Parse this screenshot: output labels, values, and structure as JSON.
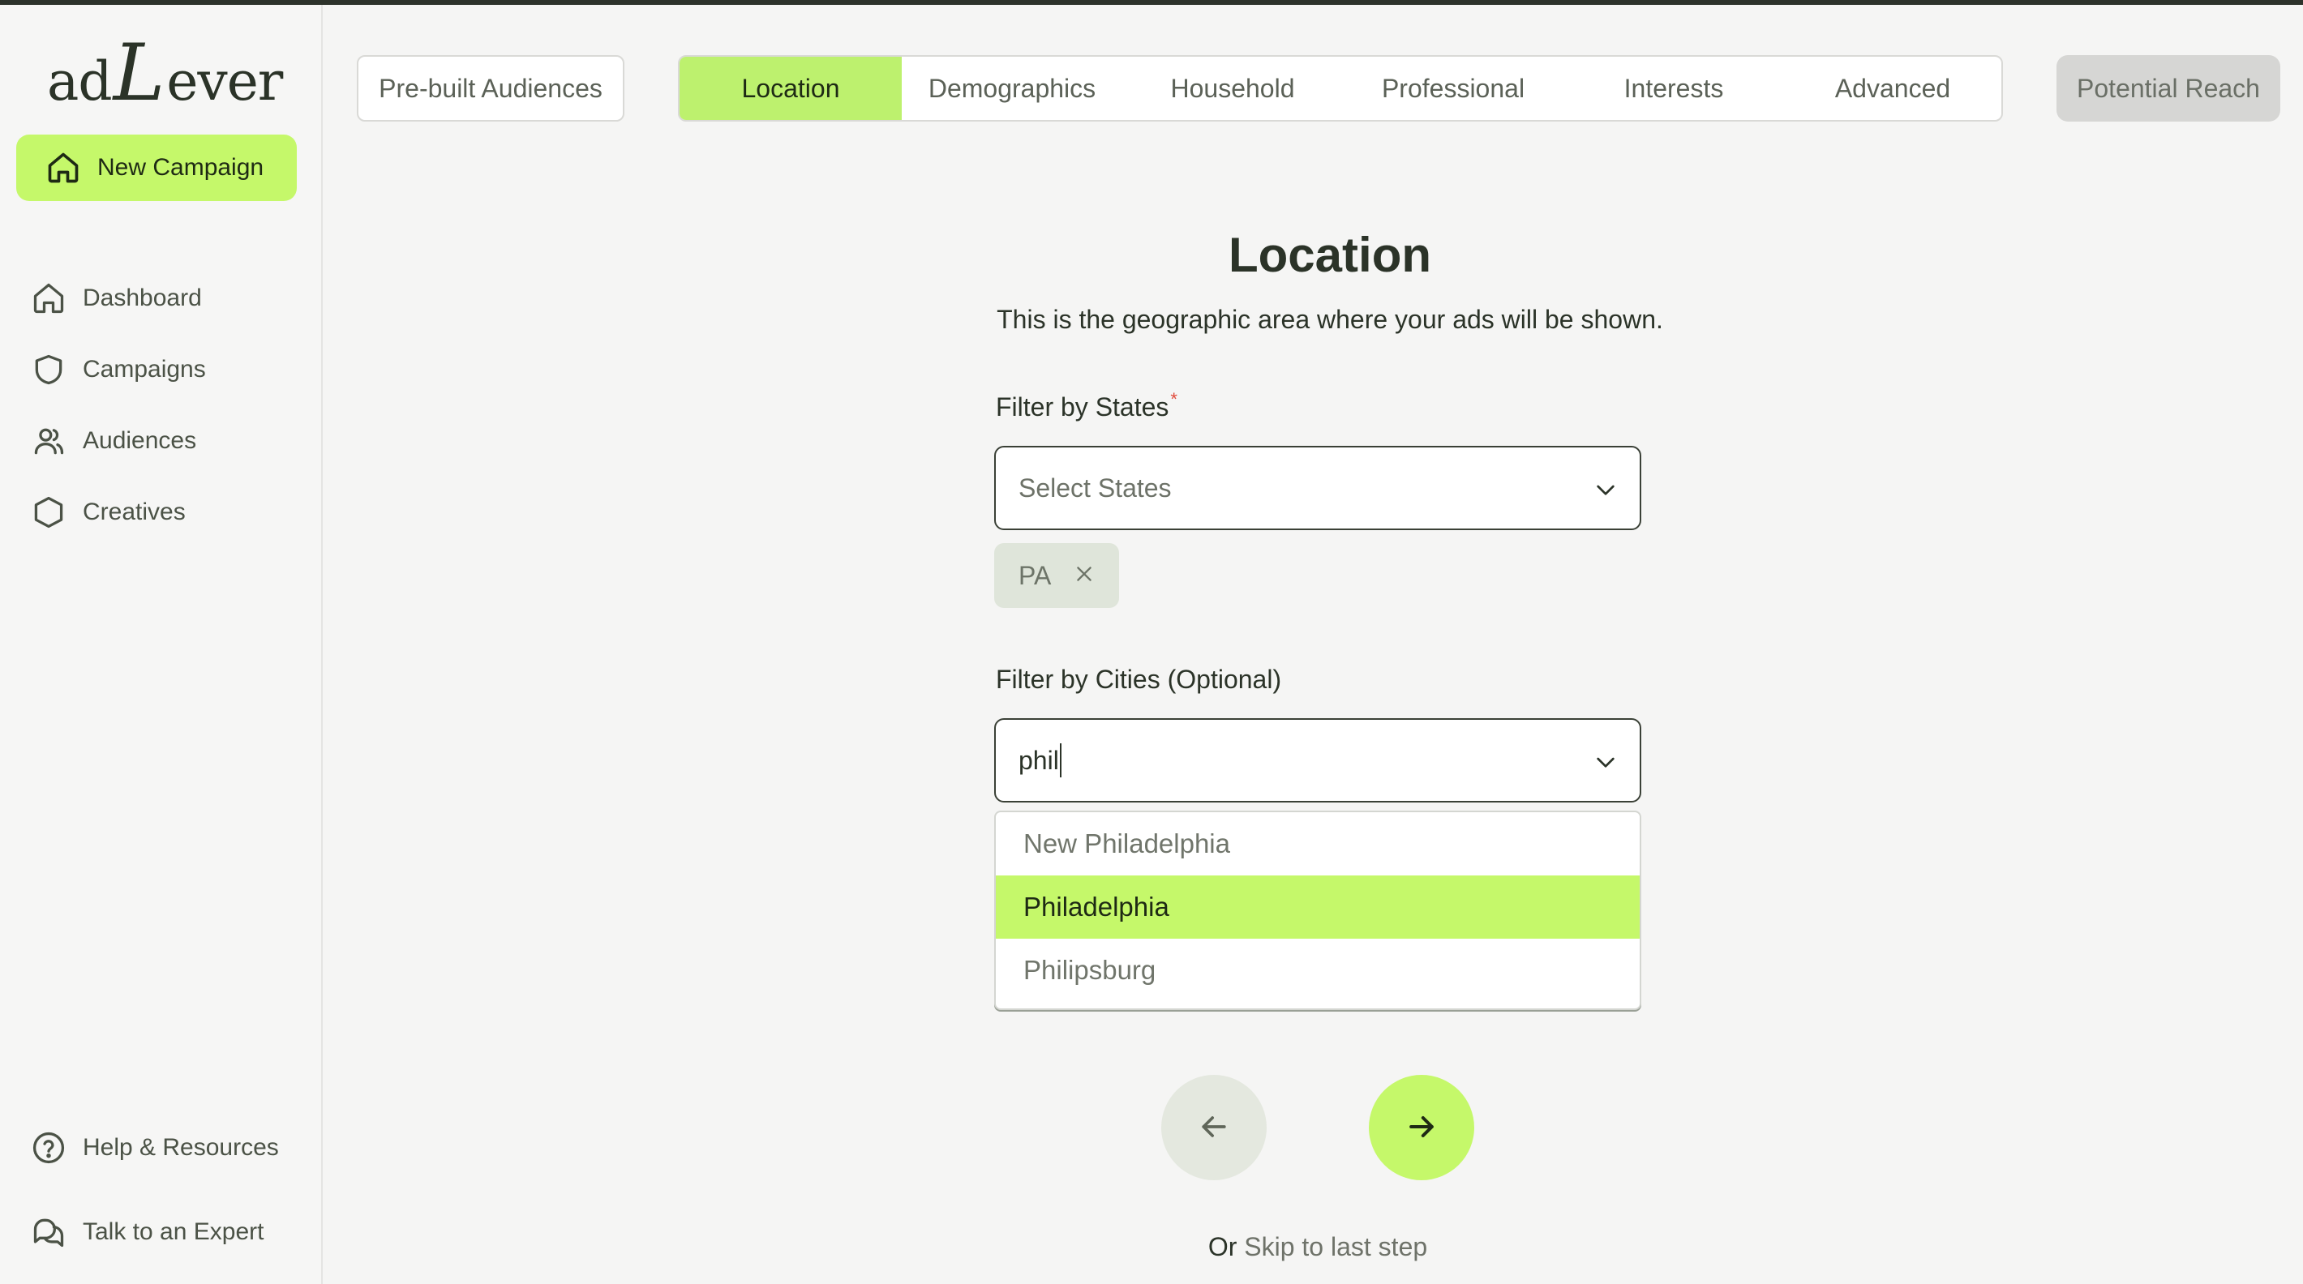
{
  "brand": {
    "logo_ad": "ad",
    "logo_L": "L",
    "logo_ever": "ever"
  },
  "sidebar": {
    "new_campaign_label": "New Campaign",
    "items": [
      {
        "label": "Dashboard",
        "icon": "home-icon"
      },
      {
        "label": "Campaigns",
        "icon": "shield-icon"
      },
      {
        "label": "Audiences",
        "icon": "users-icon"
      },
      {
        "label": "Creatives",
        "icon": "hexagon-icon"
      }
    ],
    "bottom_items": [
      {
        "label": "Help & Resources",
        "icon": "help-circle-icon"
      },
      {
        "label": "Talk to an Expert",
        "icon": "chat-icon"
      }
    ]
  },
  "header": {
    "prebuilt_label": "Pre-built Audiences",
    "tabs": [
      "Location",
      "Demographics",
      "Household",
      "Professional",
      "Interests",
      "Advanced"
    ],
    "active_tab": "Location",
    "potential_reach_label": "Potential Reach"
  },
  "main": {
    "title": "Location",
    "subtitle": "This is the geographic area where your ads will be shown.",
    "states": {
      "label": "Filter by States",
      "required_mark": "*",
      "placeholder": "Select States",
      "selected_chips": [
        "PA"
      ]
    },
    "cities": {
      "label": "Filter by Cities (Optional)",
      "input_value": "phil",
      "options": [
        "New Philadelphia",
        "Philadelphia",
        "Philipsburg"
      ],
      "highlighted_option": "Philadelphia"
    },
    "skip": {
      "prefix": "Or",
      "link": "Skip to last step"
    }
  },
  "colors": {
    "accent": "#c5f86a",
    "dark": "#2b3328",
    "required": "#e04b3c"
  }
}
